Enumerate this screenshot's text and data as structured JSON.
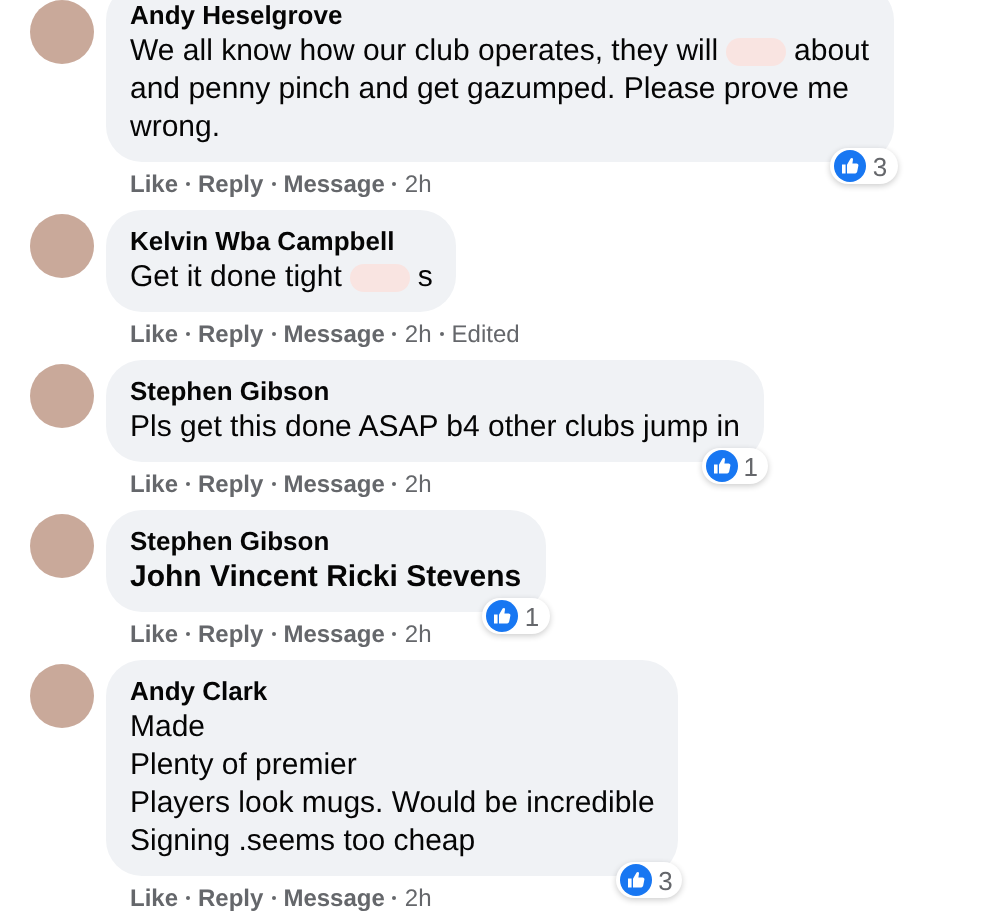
{
  "comments": [
    {
      "author": "Andy Heselgrove",
      "lines": [
        [
          {
            "kind": "text",
            "text": "We all know how our club operates, they will"
          },
          {
            "kind": "blur"
          },
          {
            "kind": "text",
            "text": "about"
          }
        ],
        [
          {
            "kind": "text",
            "text": "and penny pinch and get gazumped. Please prove me"
          }
        ],
        [
          {
            "kind": "text",
            "text": "wrong."
          }
        ]
      ],
      "actions": [
        "Like",
        "Reply",
        "Message"
      ],
      "time": "2h",
      "reactions": "3"
    },
    {
      "author": "Kelvin Wba Campbell",
      "lines": [
        [
          {
            "kind": "text",
            "text": "Get it done tight"
          },
          {
            "kind": "blur"
          },
          {
            "kind": "text",
            "text": "s"
          }
        ]
      ],
      "actions": [
        "Like",
        "Reply",
        "Message"
      ],
      "time": "2h",
      "edited": "Edited"
    },
    {
      "author": "Stephen Gibson",
      "lines": [
        [
          {
            "kind": "text",
            "text": "Pls get this done ASAP b4 other clubs jump in"
          }
        ]
      ],
      "actions": [
        "Like",
        "Reply",
        "Message"
      ],
      "time": "2h",
      "reactions": "1"
    },
    {
      "author": "Stephen Gibson",
      "lines": [
        [
          {
            "kind": "mention",
            "text": "John Vincent Ricki Stevens"
          }
        ]
      ],
      "actions": [
        "Like",
        "Reply",
        "Message"
      ],
      "time": "2h",
      "reactions": "1"
    },
    {
      "author": "Andy Clark",
      "lines": [
        [
          {
            "kind": "text",
            "text": "Made"
          }
        ],
        [
          {
            "kind": "text",
            "text": "Plenty of premier"
          }
        ],
        [
          {
            "kind": "text",
            "text": "Players look mugs. Would be incredible"
          }
        ],
        [
          {
            "kind": "text",
            "text": "Signing .seems too cheap"
          }
        ]
      ],
      "actions": [
        "Like",
        "Reply",
        "Message"
      ],
      "time": "2h",
      "reactions": "3"
    }
  ]
}
